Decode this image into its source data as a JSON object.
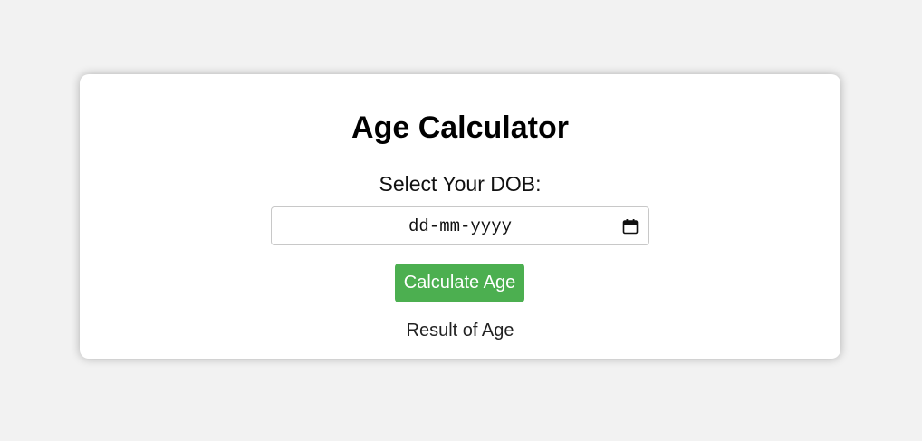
{
  "app": {
    "title": "Age Calculator"
  },
  "form": {
    "dob_label": "Select Your DOB:",
    "date_placeholder": "dd-mm-yyyy",
    "date_value": "",
    "calendar_icon": "calendar-icon",
    "calculate_label": "Calculate Age"
  },
  "result": {
    "text": "Result of Age"
  },
  "colors": {
    "background": "#f2f2f2",
    "card": "#ffffff",
    "button": "#4caf50",
    "button_text": "#ffffff"
  }
}
